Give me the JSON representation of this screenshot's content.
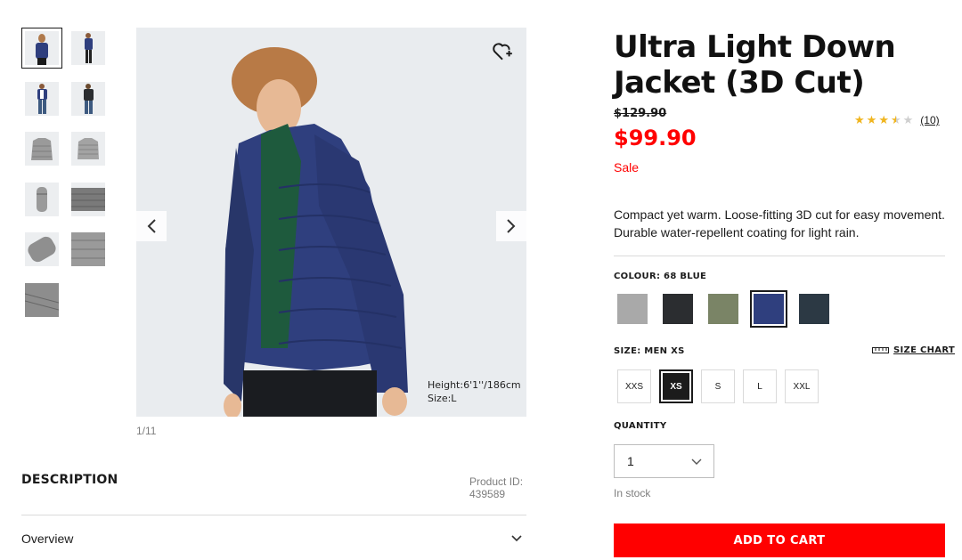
{
  "gallery": {
    "thumbnails": [
      {
        "name": "model-front",
        "active": true
      },
      {
        "name": "model-side",
        "active": false
      },
      {
        "name": "model-open",
        "active": false
      },
      {
        "name": "model-back",
        "active": false
      },
      {
        "name": "jacket-front",
        "active": false
      },
      {
        "name": "jacket-back",
        "active": false
      },
      {
        "name": "pouch",
        "active": false
      },
      {
        "name": "jacket-flat",
        "active": false
      },
      {
        "name": "detail-quilt",
        "active": false
      },
      {
        "name": "detail-fabric",
        "active": false
      },
      {
        "name": "detail-zip",
        "active": false
      }
    ],
    "model_height": "Height:6'1''/186cm",
    "model_size": "Size:L",
    "counter": "1/11"
  },
  "description": {
    "title": "DESCRIPTION",
    "product_id_label": "Product ID:",
    "product_id": "439589",
    "overview_label": "Overview"
  },
  "product": {
    "title": "Ultra Light Down Jacket (3D Cut)",
    "old_price": "$129.90",
    "price": "$99.90",
    "sale_label": "Sale",
    "rating": 3.5,
    "review_count": "(10)",
    "blurb": "Compact yet warm. Loose-fitting 3D cut for easy movement. Durable water-repellent coating for light rain.",
    "colour_label": "COLOUR: 68 BLUE",
    "colours": [
      {
        "name": "gray",
        "hex": "#a9a9a9",
        "selected": false
      },
      {
        "name": "black",
        "hex": "#2b2d30",
        "selected": false
      },
      {
        "name": "olive",
        "hex": "#7a8466",
        "selected": false
      },
      {
        "name": "blue",
        "hex": "#2f3f7e",
        "selected": true
      },
      {
        "name": "navy",
        "hex": "#2c3944",
        "selected": false
      }
    ],
    "size_label": "SIZE: MEN XS",
    "size_chart_label": "SIZE CHART",
    "sizes": [
      {
        "label": "XXS",
        "selected": false
      },
      {
        "label": "XS",
        "selected": true
      },
      {
        "label": "S",
        "selected": false
      },
      {
        "label": "L",
        "selected": false
      },
      {
        "label": "XXL",
        "selected": false
      }
    ],
    "quantity_label": "QUANTITY",
    "quantity": "1",
    "stock": "In stock",
    "cart_button": "ADD TO CART"
  },
  "colors": {
    "accent": "#ff0000",
    "star": "#f0b51f",
    "text": "#1b1b1b"
  }
}
